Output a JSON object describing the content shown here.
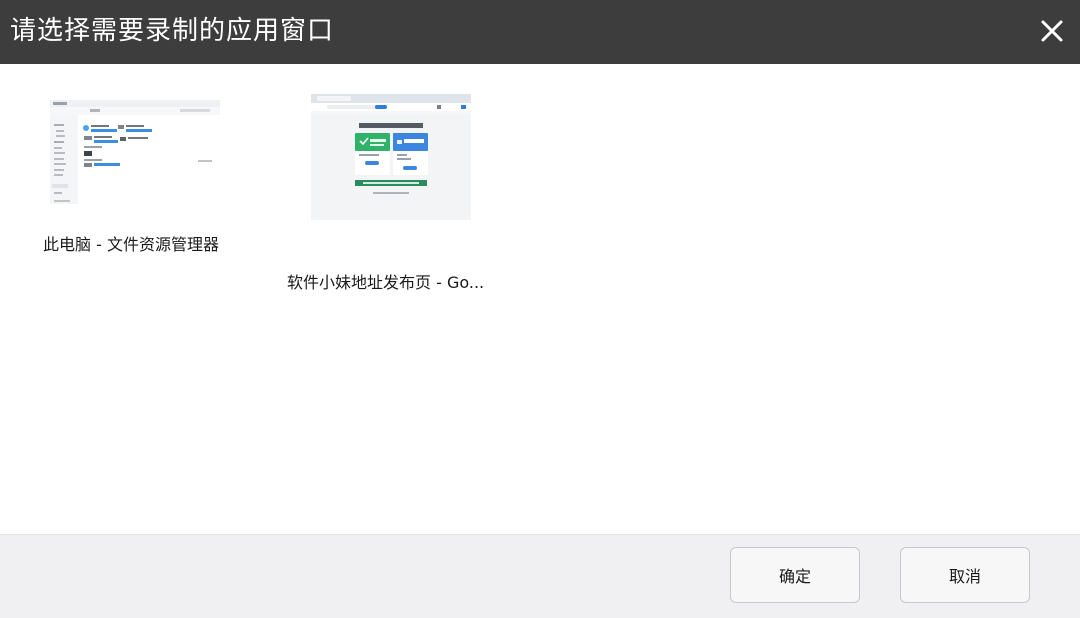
{
  "dialog": {
    "title": "请选择需要录制的应用窗口"
  },
  "windows": [
    {
      "label": "此电脑 - 文件资源管理器"
    },
    {
      "label": "软件小妹地址发布页 - Go..."
    }
  ],
  "footer": {
    "confirm_label": "确定",
    "cancel_label": "取消"
  },
  "colors": {
    "titlebar": "#3d3d3d",
    "footer": "#f0f0f2",
    "thumb_green": "#2fb36a",
    "thumb_blue": "#3d86e0"
  }
}
